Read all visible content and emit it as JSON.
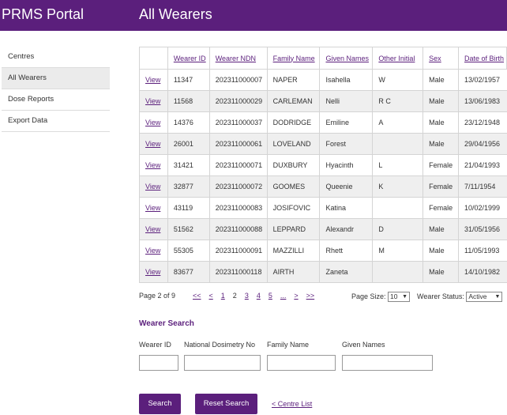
{
  "header": {
    "brand": "PRMS Portal",
    "title": "All Wearers"
  },
  "sidebar": {
    "items": [
      {
        "label": "Centres"
      },
      {
        "label": "All Wearers",
        "active": true
      },
      {
        "label": "Dose Reports"
      },
      {
        "label": "Export Data"
      }
    ]
  },
  "table": {
    "columns": [
      "",
      "Wearer ID",
      "Wearer NDN",
      "Family Name",
      "Given Names",
      "Other Initial",
      "Sex",
      "Date of Birth"
    ],
    "rows": [
      {
        "view": "View",
        "id": "11347",
        "ndn": "202311000007",
        "family": "NAPER",
        "given": "Isahella",
        "initial": "W",
        "sex": "Male",
        "dob": "13/02/1957"
      },
      {
        "view": "View",
        "id": "11568",
        "ndn": "202311000029",
        "family": "CARLEMAN",
        "given": "Nelli",
        "initial": "R C",
        "sex": "Male",
        "dob": "13/06/1983"
      },
      {
        "view": "View",
        "id": "14376",
        "ndn": "202311000037",
        "family": "DODRIDGE",
        "given": "Emiline",
        "initial": "A",
        "sex": "Male",
        "dob": "23/12/1948"
      },
      {
        "view": "View",
        "id": "26001",
        "ndn": "202311000061",
        "family": "LOVELAND",
        "given": "Forest",
        "initial": "",
        "sex": "Male",
        "dob": "29/04/1956"
      },
      {
        "view": "View",
        "id": "31421",
        "ndn": "202311000071",
        "family": "DUXBURY",
        "given": "Hyacinth",
        "initial": "L",
        "sex": "Female",
        "dob": "21/04/1993"
      },
      {
        "view": "View",
        "id": "32877",
        "ndn": "202311000072",
        "family": "GOOMES",
        "given": "Queenie",
        "initial": "K",
        "sex": "Female",
        "dob": "7/11/1954"
      },
      {
        "view": "View",
        "id": "43119",
        "ndn": "202311000083",
        "family": "JOSIFOVIC",
        "given": "Katina",
        "initial": "",
        "sex": "Female",
        "dob": "10/02/1999"
      },
      {
        "view": "View",
        "id": "51562",
        "ndn": "202311000088",
        "family": "LEPPARD",
        "given": "Alexandr",
        "initial": "D",
        "sex": "Male",
        "dob": "31/05/1956"
      },
      {
        "view": "View",
        "id": "55305",
        "ndn": "202311000091",
        "family": "MAZZILLI",
        "given": "Rhett",
        "initial": "M",
        "sex": "Male",
        "dob": "11/05/1993"
      },
      {
        "view": "View",
        "id": "83677",
        "ndn": "202311000118",
        "family": "AIRTH",
        "given": "Zaneta",
        "initial": "",
        "sex": "Male",
        "dob": "14/10/1982"
      }
    ]
  },
  "pager": {
    "status": "Page 2 of 9",
    "links": [
      "<<",
      "<",
      "1",
      "2",
      "3",
      "4",
      "5",
      "...",
      ">",
      ">>"
    ],
    "current": "2",
    "page_size_label": "Page Size:",
    "page_size_value": "10",
    "wearer_status_label": "Wearer Status:",
    "wearer_status_value": "Active"
  },
  "search": {
    "heading": "Wearer Search",
    "labels": {
      "wearer_id": "Wearer ID",
      "ndn": "National Dosimetry No",
      "family": "Family Name",
      "given": "Given Names"
    },
    "values": {
      "wearer_id": "",
      "ndn": "",
      "family": "",
      "given": ""
    },
    "search_button": "Search",
    "reset_button": "Reset Search",
    "centre_link": "< Centre List"
  },
  "colors": {
    "brand": "#5b1f7c",
    "row_alt": "#efefef"
  }
}
